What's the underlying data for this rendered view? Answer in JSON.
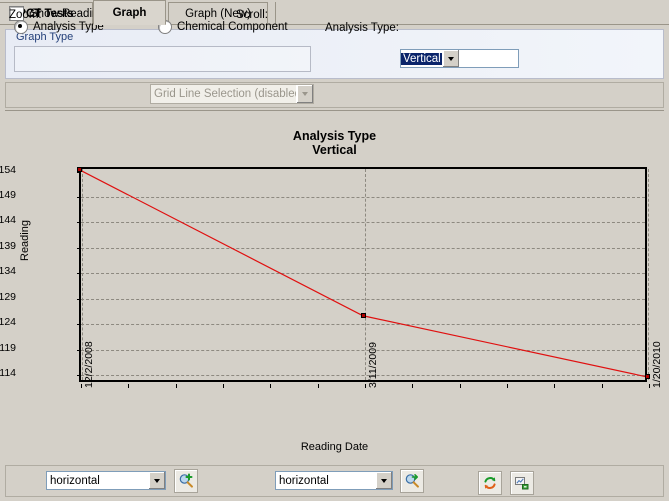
{
  "tabs": [
    {
      "label": "PCT Tests",
      "selected": false
    },
    {
      "label": "Graph",
      "selected": true
    },
    {
      "label": "Graph (New)",
      "selected": false
    }
  ],
  "options": {
    "group_label": "Graph Type",
    "radio_analysis_type": "Analysis Type",
    "radio_chemical_component": "Chemical Component",
    "analysis_type_label": "Analysis Type:",
    "analysis_type_value": "Vertical",
    "show_reading_labels": "Show Reading Labels",
    "grid_line_selection": "Grid Line Selection (disabled)"
  },
  "toolbar": {
    "zoom_label": "Zoom:",
    "zoom_value": "horizontal",
    "scroll_label": "Scroll:",
    "scroll_value": "horizontal",
    "zoom_apply_icon": "magnifier-plus-icon",
    "scroll_apply_icon": "magnifier-arrow-icon",
    "reset_icon": "refresh-arrows-icon",
    "export_icon": "chart-export-icon"
  },
  "chart_data": {
    "type": "line",
    "title": "Analysis Type",
    "subtitle": "Vertical",
    "xlabel": "Reading Date",
    "ylabel": "Reading",
    "x": [
      "12/2/2008",
      "3/11/2009",
      "1/20/2010"
    ],
    "values": [
      0.154,
      0.1253,
      0.1133
    ],
    "ylim": [
      0.1123,
      0.1545
    ],
    "yticks": [
      0.154,
      0.149,
      0.144,
      0.139,
      0.134,
      0.129,
      0.124,
      0.119,
      0.114
    ],
    "ytick_labels": [
      "0.154",
      "0.149",
      "0.144",
      "0.139",
      "0.134",
      "0.129",
      "0.124",
      "0.119",
      "0.114"
    ],
    "xticks": [
      "12/2/2008",
      "3/11/2009",
      "1/20/2010"
    ],
    "grid": true,
    "legend": "none",
    "line_color": "#e01010",
    "marker_color": "#b00000"
  }
}
